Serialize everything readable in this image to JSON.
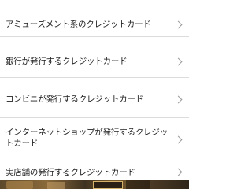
{
  "menu": {
    "items": [
      {
        "label": "アミューズメント系のクレジットカード"
      },
      {
        "label": "銀行が発行するクレジットカード"
      },
      {
        "label": "コンビニが発行するクレジットカード"
      },
      {
        "label": "インターネットショップが発行するクレジットカード"
      },
      {
        "label": "実店舗の発行するクレジットカード"
      }
    ],
    "chevron_icon": "chevron-right-icon"
  },
  "ad_banner": {
    "icon": "game-ad-banner"
  }
}
